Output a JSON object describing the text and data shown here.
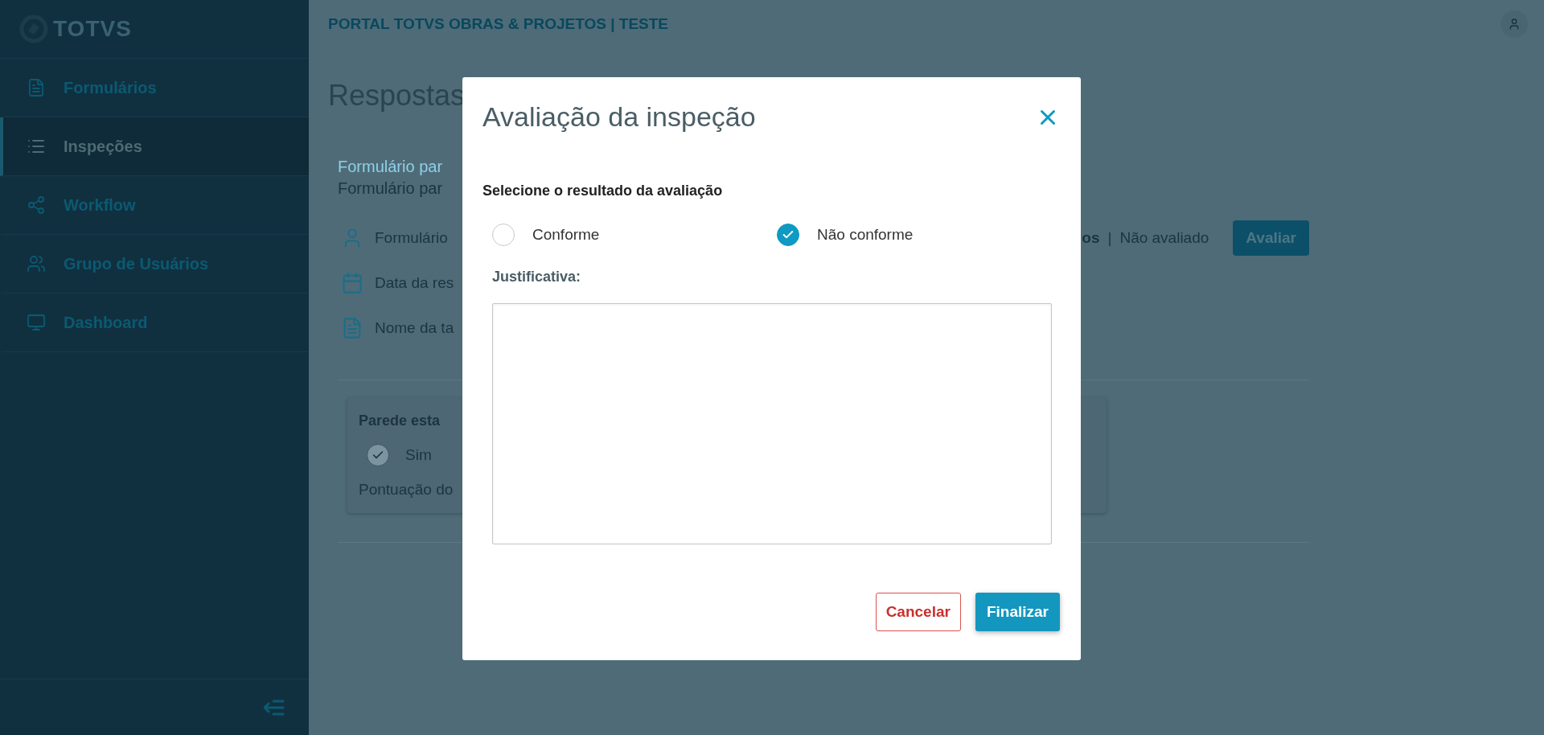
{
  "sidebar": {
    "logo": "TOTVS",
    "items": [
      {
        "kind": "form",
        "label": "Formulários",
        "selected": false
      },
      {
        "kind": "list",
        "label": "Inspeções",
        "selected": true
      },
      {
        "kind": "share",
        "label": "Workflow",
        "selected": false
      },
      {
        "kind": "users",
        "label": "Grupo de Usuários",
        "selected": false
      },
      {
        "kind": "monitor",
        "label": "Dashboard",
        "selected": false
      }
    ]
  },
  "header": {
    "title": "PORTAL TOTVS OBRAS & PROJETOS | TESTE"
  },
  "page": {
    "title": "Respostas",
    "form_label": "Formulário par",
    "form_name": "Formulário par",
    "info": [
      {
        "kind": "user",
        "text": "Formulário"
      },
      {
        "kind": "calendar",
        "text": "Data da res"
      },
      {
        "kind": "document",
        "text": "Nome da ta"
      }
    ],
    "status_prefix": "os",
    "status_separator": "|",
    "status": "Não avaliado",
    "evaluate_button": "Avaliar",
    "question_card": {
      "title": "Parede esta",
      "option": {
        "label": "Sim",
        "checked": true
      },
      "score_label": "Pontuação do"
    }
  },
  "modal": {
    "title": "Avaliação da inspeção",
    "prompt": "Selecione o resultado da avaliação",
    "options": [
      {
        "label": "Conforme",
        "selected": false
      },
      {
        "label": "Não conforme",
        "selected": true
      }
    ],
    "justification_label": "Justificativa:",
    "cancel_button": "Cancelar",
    "confirm_button": "Finalizar"
  }
}
